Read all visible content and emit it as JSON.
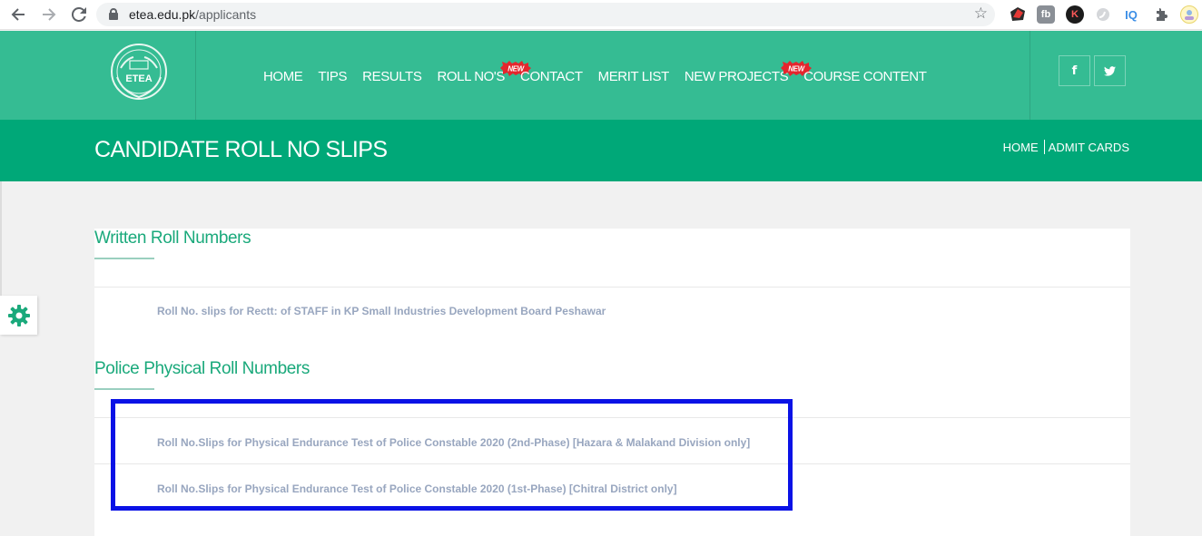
{
  "browser": {
    "url_host": "etea.edu.pk",
    "url_path": "/applicants",
    "back_icon": "back-arrow-icon",
    "forward_icon": "forward-arrow-icon",
    "reload_icon": "reload-icon",
    "extensions": [
      "extension-red-icon",
      "extension-fb-icon",
      "extension-k-icon",
      "extension-grey-icon",
      "extension-iq-icon",
      "puzzle-icon",
      "profile-avatar-icon"
    ],
    "ext_fb_label": "fb",
    "ext_k_label": "K",
    "ext_iq_label": "IQ"
  },
  "header": {
    "logo_text": "ETEA",
    "nav": [
      "HOME",
      "TIPS",
      "RESULTS",
      "ROLL NO'S",
      "CONTACT",
      "MERIT LIST",
      "NEW PROJECTS",
      "COURSE CONTENT"
    ],
    "new_badge": "NEW",
    "social": {
      "facebook": "f",
      "twitter": "twitter-icon"
    }
  },
  "title_band": {
    "title": "CANDIDATE ROLL NO SLIPS",
    "breadcrumb": [
      "HOME",
      "ADMIT CARDS"
    ]
  },
  "sections": [
    {
      "heading": "Written Roll Numbers",
      "links": [
        "Roll No. slips for Rectt: of STAFF in KP Small Industries Development Board Peshawar"
      ]
    },
    {
      "heading": "Police Physical Roll Numbers",
      "links": [
        "Roll No.Slips for Physical Endurance Test of Police Constable 2020 (2nd-Phase) [Hazara & Malakand Division only]",
        "Roll No.Slips for Physical Endurance Test of Police Constable 2020 (1st-Phase) [Chitral District only]"
      ]
    }
  ],
  "colors": {
    "header": "#35bc93",
    "title_band": "#00a878",
    "heading": "#1aa97b",
    "link": "#98a6bf",
    "highlight": "#0a12e6"
  }
}
